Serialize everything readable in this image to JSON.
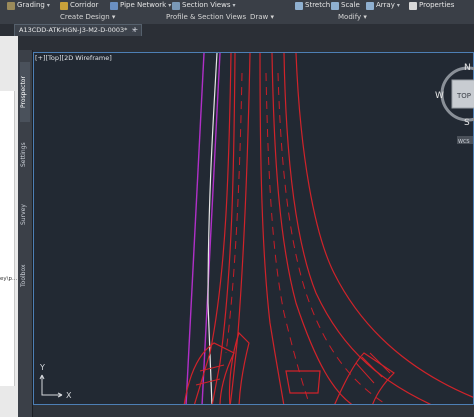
{
  "ribbon": {
    "items": [
      {
        "label": "Grading",
        "icon": "grading-icon",
        "color": "#9a8a5a",
        "caret": "▾"
      },
      {
        "label": "Corridor",
        "icon": "corridor-icon",
        "color": "#c9a23a",
        "caret": ""
      },
      {
        "label": "Pipe Network",
        "icon": "pipe-network-icon",
        "color": "#6a8fc2",
        "caret": "▾"
      },
      {
        "label": "Section Views",
        "icon": "section-views-icon",
        "color": "#7a99b8",
        "caret": "▾"
      },
      {
        "label": "Stretch",
        "icon": "stretch-icon",
        "color": "#8fb0d0",
        "caret": ""
      },
      {
        "label": "Scale",
        "icon": "scale-icon",
        "color": "#8fb0d0",
        "caret": ""
      },
      {
        "label": "Array",
        "icon": "array-icon",
        "color": "#8fb0d0",
        "caret": "▾"
      },
      {
        "label": "Properties",
        "icon": "properties-icon",
        "color": "#d9d9d9",
        "caret": ""
      }
    ],
    "groups": [
      "Create Design ▾",
      "Profile & Section Views",
      "Draw ▾",
      "Modify ▾"
    ]
  },
  "tabs": {
    "doc_tab": "A13CDD-ATK-HGN-J3-M2-D-0003*",
    "close": "×",
    "add": "+"
  },
  "left_panel": {
    "fragment_text": "ey\\p..."
  },
  "toolspace": {
    "tabs": [
      "Prospector",
      "Settings",
      "Survey",
      "Toolbox"
    ]
  },
  "viewport": {
    "label": "[+][Top][2D Wireframe]",
    "line_colors": {
      "red": "#d0232a",
      "magenta": "#b030c8",
      "white": "#e6e6e6",
      "dashed_red": "#c81e28"
    }
  },
  "viewcube": {
    "n": "N",
    "w": "W",
    "s": "S",
    "top": "TOP",
    "wcs": "WCS"
  },
  "ucs": {
    "x": "X",
    "y": "Y"
  }
}
